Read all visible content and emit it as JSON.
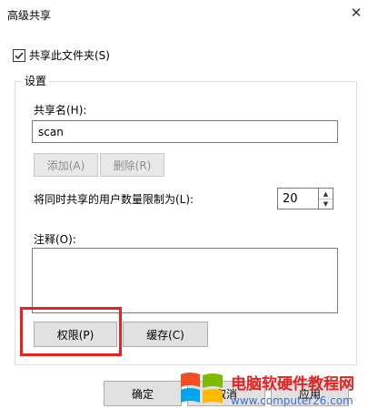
{
  "window": {
    "title": "高级共享",
    "close_glyph": "✕"
  },
  "share": {
    "checkbox_label": "共享此文件夹(S)",
    "checked": true
  },
  "settings": {
    "group_title": "设置",
    "share_name_label": "共享名(H):",
    "share_name_value": "scan",
    "add_button": "添加(A)",
    "remove_button": "删除(R)",
    "user_limit_label": "将同时共享的用户数量限制为(L):",
    "user_limit_value": "20",
    "comment_label": "注释(O):",
    "comment_value": "",
    "permissions_button": "权限(P)",
    "caching_button": "缓存(C)"
  },
  "footer": {
    "ok_button": "确定",
    "cancel_button": "取消",
    "apply_button": "应用"
  },
  "watermark": {
    "line1": "电脑软硬件教程网",
    "line2": "www.computer26.com"
  },
  "colors": {
    "highlight": "#e8201f",
    "watermark_red": "#e8201f",
    "watermark_blue": "#3b6fd8"
  }
}
